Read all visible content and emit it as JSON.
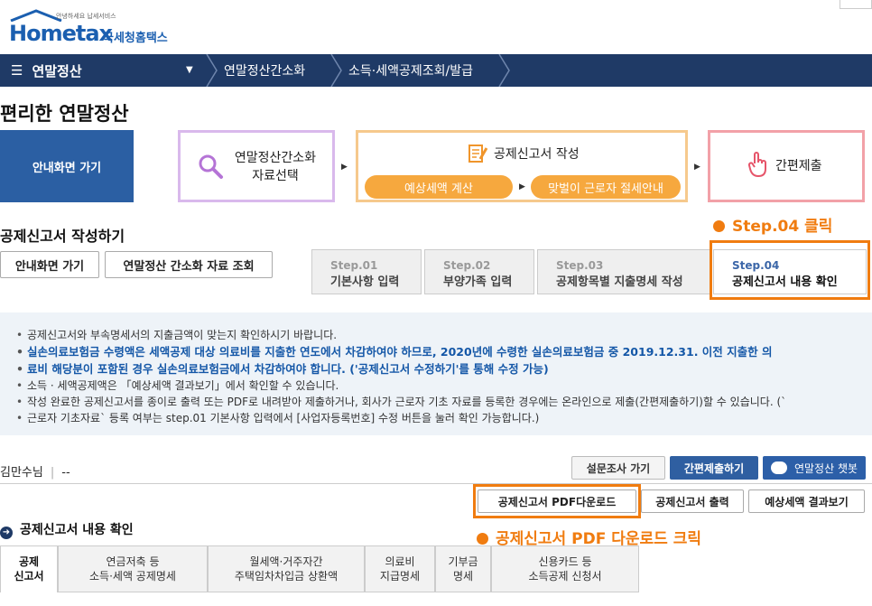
{
  "logo": {
    "mini": "안녕하세요 납세서비스",
    "word": "Hometax",
    "kor": "국세청홈택스"
  },
  "nav": {
    "menu": "연말정산",
    "crumbs": [
      "연말정산간소화",
      "소득·세액공제조회/발급"
    ]
  },
  "page_title": "편리한 연말정산",
  "flow": {
    "guide_button": "안내화면 가기",
    "card1": [
      "연말정산간소화",
      "자료선택"
    ],
    "card2_title": "공제신고서 작성",
    "pill1": "예상세액 계산",
    "pill2": "맞벌이 근로자 절세안내",
    "card3": "간편제출"
  },
  "section_title": "공제신고서 작성하기",
  "step_note": "Step.04 클릭",
  "left_buttons": [
    "안내화면 가기",
    "연말정산 간소화 자료 조회"
  ],
  "steps": [
    {
      "num": "Step.01",
      "label": "기본사항 입력"
    },
    {
      "num": "Step.02",
      "label": "부양가족 입력"
    },
    {
      "num": "Step.03",
      "label": "공제항목별 지출명세 작성"
    },
    {
      "num": "Step.04",
      "label": "공제신고서 내용 확인"
    }
  ],
  "notice": {
    "line1": "공제신고서와 부속명세서의 지출금액이 맞는지 확인하시기 바랍니다.",
    "line2a": "실손의료보험금 수령액은 세액공제 대상 의료비를 지출한 연도에서 차감하여야 하므로, 2020년에 수령한 실손의료보험금 중 2019.12.31. 이전 지출한 의",
    "line2b": "료비 해당분이 포함된 경우 실손의료보험금에서 차감하여야 합니다. ('공제신고서 수정하기'를 통해 수정 가능)",
    "line3": "소득 · 세액공제액은 「예상세액 결과보기」에서 확인할 수 있습니다.",
    "line4a": "작성 완료한 공제신고서를 종이로 출력 또는 PDF로 내려받아 제출하거나, 회사가 근로자 기초 자료를 등록한 경우에는 온라인으로 제출(간편제출하기)할 수 있습니다. (`",
    "line4b": "근로자 기초자료` 등록 여부는 step.01 기본사항 입력에서 [사업자등록번호] 수정 버튼을 눌러 확인 가능합니다.)"
  },
  "user": {
    "name": "김만수",
    "suffix": "님",
    "value": "--"
  },
  "top_right_buttons": {
    "survey": "설문조사 가기",
    "quick_submit": "간편제출하기",
    "chatbot": "연말정산 챗봇"
  },
  "action_buttons": {
    "pdf": "공제신고서 PDF다운로드",
    "print": "공제신고서 출력",
    "expected": "예상세액 결과보기"
  },
  "pdf_note": "공제신고서 PDF 다운로드 크릭",
  "confirm_title": "공제신고서 내용 확인",
  "bottom_tabs": [
    [
      "공제",
      "신고서"
    ],
    [
      "연금저축 등",
      "소득·세액 공제명세"
    ],
    [
      "월세액·거주자간",
      "주택임차차입금 상환액"
    ],
    [
      "의료비",
      "지급명세"
    ],
    [
      "기부금",
      "명세"
    ],
    [
      "신용카드 등",
      "소득공제 신청서"
    ]
  ],
  "colors": {
    "navy": "#1f3a66",
    "accent": "#f07c10",
    "blue": "#2b5fa3",
    "pill": "#f6a83e"
  }
}
